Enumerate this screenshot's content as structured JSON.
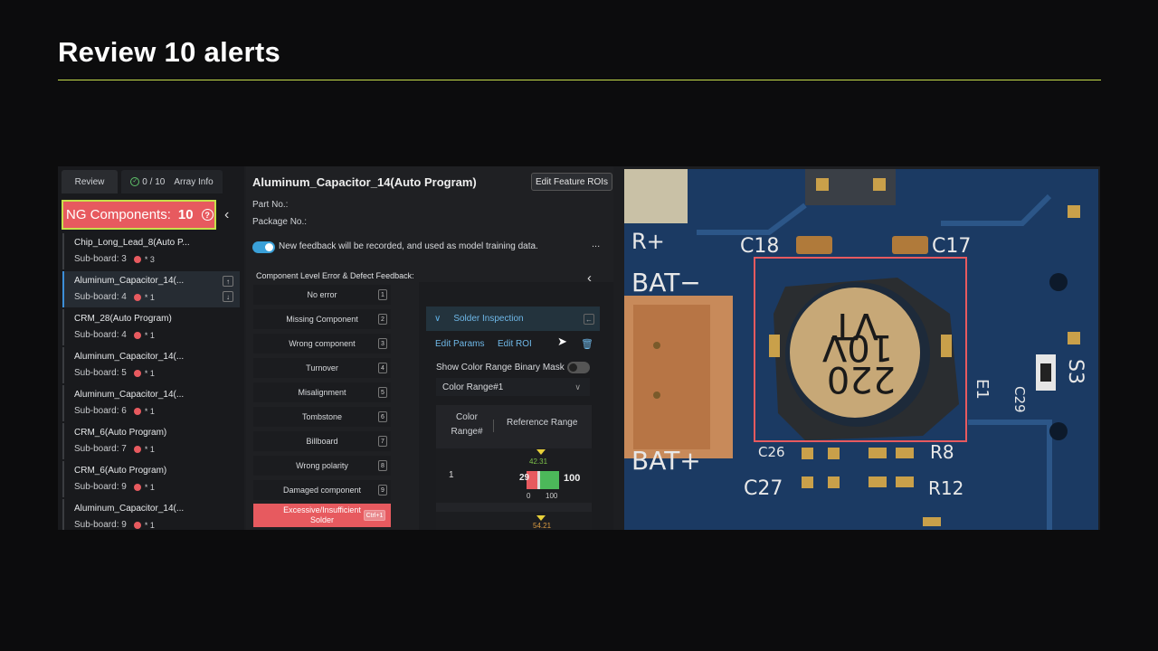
{
  "page_title": "Review 10 alerts",
  "left_panel": {
    "tabs": [
      {
        "label": "Review"
      },
      {
        "label": "0 / 10",
        "label2": "Array Info"
      }
    ],
    "ng_label": "NG Components:",
    "ng_count": "10",
    "help": "?",
    "collapse": "‹",
    "components": [
      {
        "name": "Chip_Long_Lead_8(Auto P...",
        "sub": "Sub-board: 3",
        "count": "* 3"
      },
      {
        "name": "Aluminum_Capacitor_14(...",
        "sub": "Sub-board: 4",
        "count": "* 1"
      },
      {
        "name": "CRM_28(Auto Program)",
        "sub": "Sub-board: 4",
        "count": "* 1"
      },
      {
        "name": "Aluminum_Capacitor_14(...",
        "sub": "Sub-board: 5",
        "count": "* 1"
      },
      {
        "name": "Aluminum_Capacitor_14(...",
        "sub": "Sub-board: 6",
        "count": "* 1"
      },
      {
        "name": "CRM_6(Auto Program)",
        "sub": "Sub-board: 7",
        "count": "* 1"
      },
      {
        "name": "CRM_6(Auto Program)",
        "sub": "Sub-board: 9",
        "count": "* 1"
      },
      {
        "name": "Aluminum_Capacitor_14(...",
        "sub": "Sub-board: 9",
        "count": "* 1"
      }
    ]
  },
  "detail": {
    "title": "Aluminum_Capacitor_14(Auto Program)",
    "edit_roi_button": "Edit Feature ROIs",
    "part_no_label": "Part No.:",
    "package_no_label": "Package No.:",
    "feedback_text": "New feedback will be recorded, and used as model training data.",
    "more": "...",
    "error_section_title": "Component Level Error & Defect Feedback:",
    "errors": [
      {
        "label": "No error",
        "key": "1"
      },
      {
        "label": "Missing Component",
        "key": "2"
      },
      {
        "label": "Wrong component",
        "key": "3"
      },
      {
        "label": "Turnover",
        "key": "4"
      },
      {
        "label": "Misalignment",
        "key": "5"
      },
      {
        "label": "Tombstone",
        "key": "6"
      },
      {
        "label": "Billboard",
        "key": "7"
      },
      {
        "label": "Wrong polarity",
        "key": "8"
      },
      {
        "label": "Damaged component",
        "key": "9"
      },
      {
        "label": "Excessive/Insufficient Solder",
        "key": "Ctrl+1"
      }
    ]
  },
  "solder": {
    "collapse": "‹",
    "section_label": "Solder Inspection",
    "edit_params": "Edit Params",
    "edit_roi": "Edit ROI",
    "mask_label": "Show Color Range Binary Mask",
    "color_range_select": "Color Range#1",
    "table_headers": {
      "col1": "Color Range#",
      "col2": "Reference Range"
    },
    "rows": [
      {
        "index": "1",
        "indicator": "42.31",
        "low": "29",
        "high": "100",
        "min": "0",
        "max": "100"
      },
      {
        "indicator": "54.21"
      }
    ]
  },
  "image_labels": [
    "R+",
    "C18",
    "C17",
    "BAT−",
    "220",
    "10V",
    "VT",
    "E1",
    "C26",
    "R8",
    "BAT+",
    "C27",
    "R12",
    "S3",
    "C29"
  ],
  "colors": {
    "accent": "#c4dc4a",
    "ng_red": "#e75a5f",
    "link_blue": "#6fb8e8",
    "toggle_on": "#3aa0d8"
  }
}
